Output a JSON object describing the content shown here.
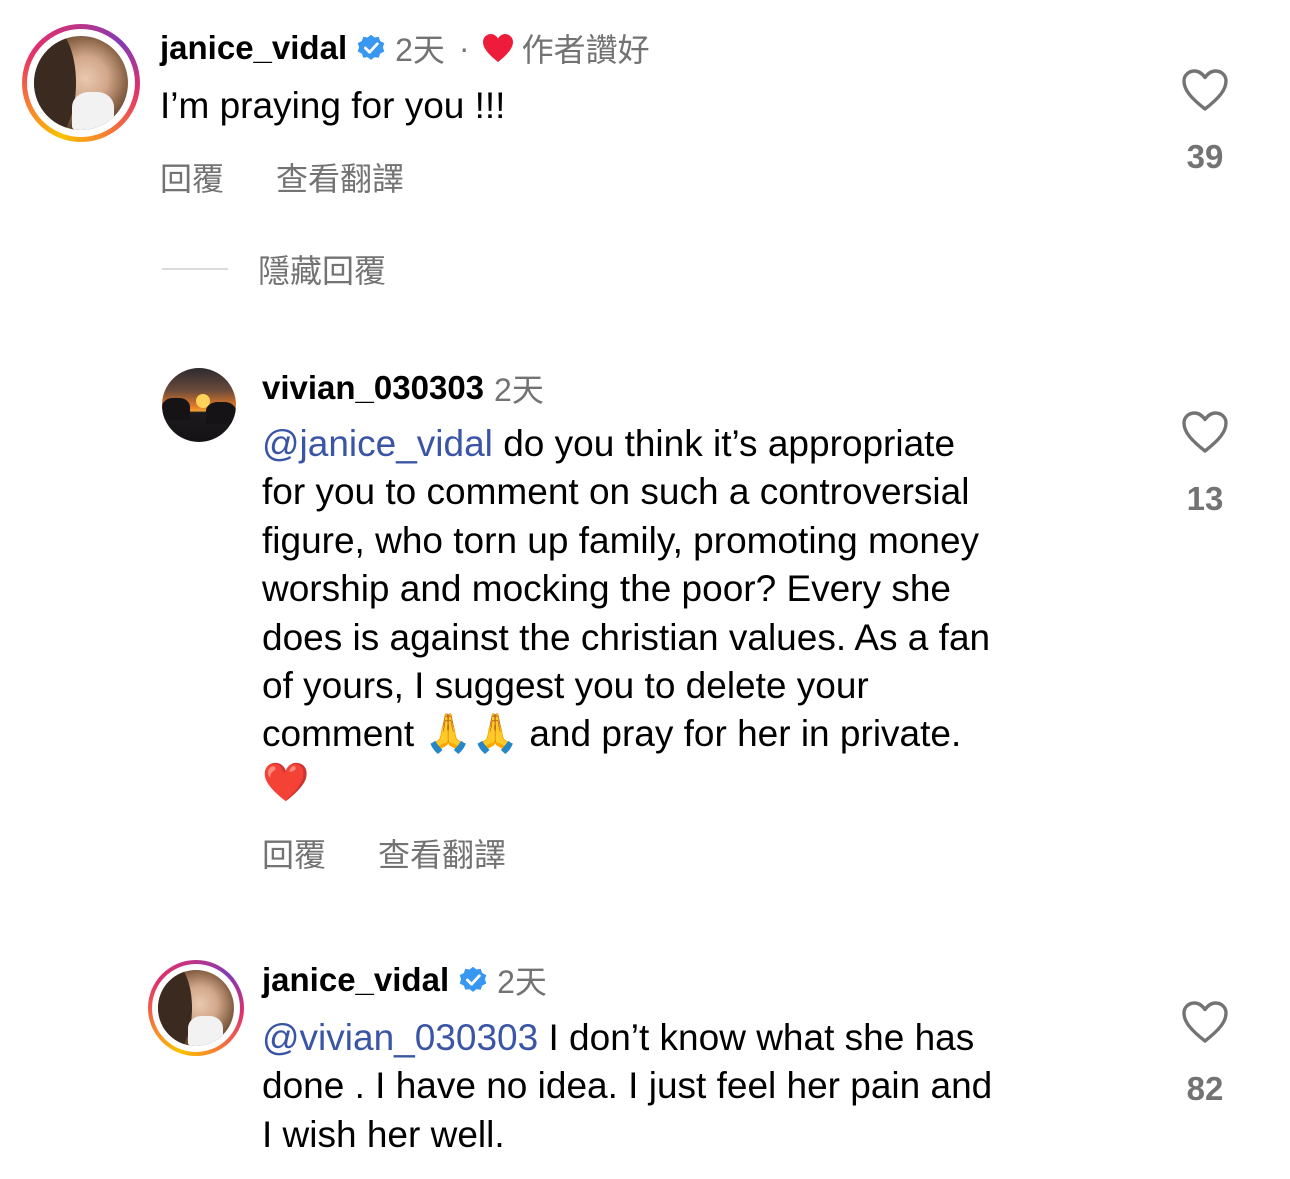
{
  "comments": [
    {
      "username": "janice_vidal",
      "verified": true,
      "time": "2天",
      "separator": "·",
      "author_liked_label": "作者讚好",
      "text_lines": [
        "I’m praying for you !!!"
      ],
      "reply_label": "回覆",
      "translate_label": "查看翻譯",
      "likes": "39"
    },
    {
      "username": "vivian_030303",
      "verified": false,
      "time": "2天",
      "mention": "@janice_vidal",
      "text_line1_rest": " do you think it’s appropriate",
      "text_lines": [
        "for you to comment on such a controversial",
        "figure, who torn up family, promoting money",
        "worship and mocking the poor? Every she",
        "does is against the christian values. As a fan",
        "of yours, I suggest you to delete your"
      ],
      "text_comment_word": "comment",
      "emoji_pray": "🙏🙏",
      "text_after_emoji": " and pray for her in private.",
      "emoji_heart": "❤️",
      "reply_label": "回覆",
      "translate_label": "查看翻譯",
      "likes": "13"
    },
    {
      "username": "janice_vidal",
      "verified": true,
      "time": "2天",
      "mention": "@vivian_030303",
      "text_line1_rest": " I don’t know what she has",
      "text_lines": [
        "done . I have no idea. I just feel her pain and",
        "I wish her well."
      ],
      "likes": "82"
    }
  ],
  "hide_replies_label": "隱藏回覆",
  "colors": {
    "mention": "#3a55a5",
    "verified": "#3897f0",
    "heart": "#ed1c3a",
    "muted": "#737373"
  }
}
